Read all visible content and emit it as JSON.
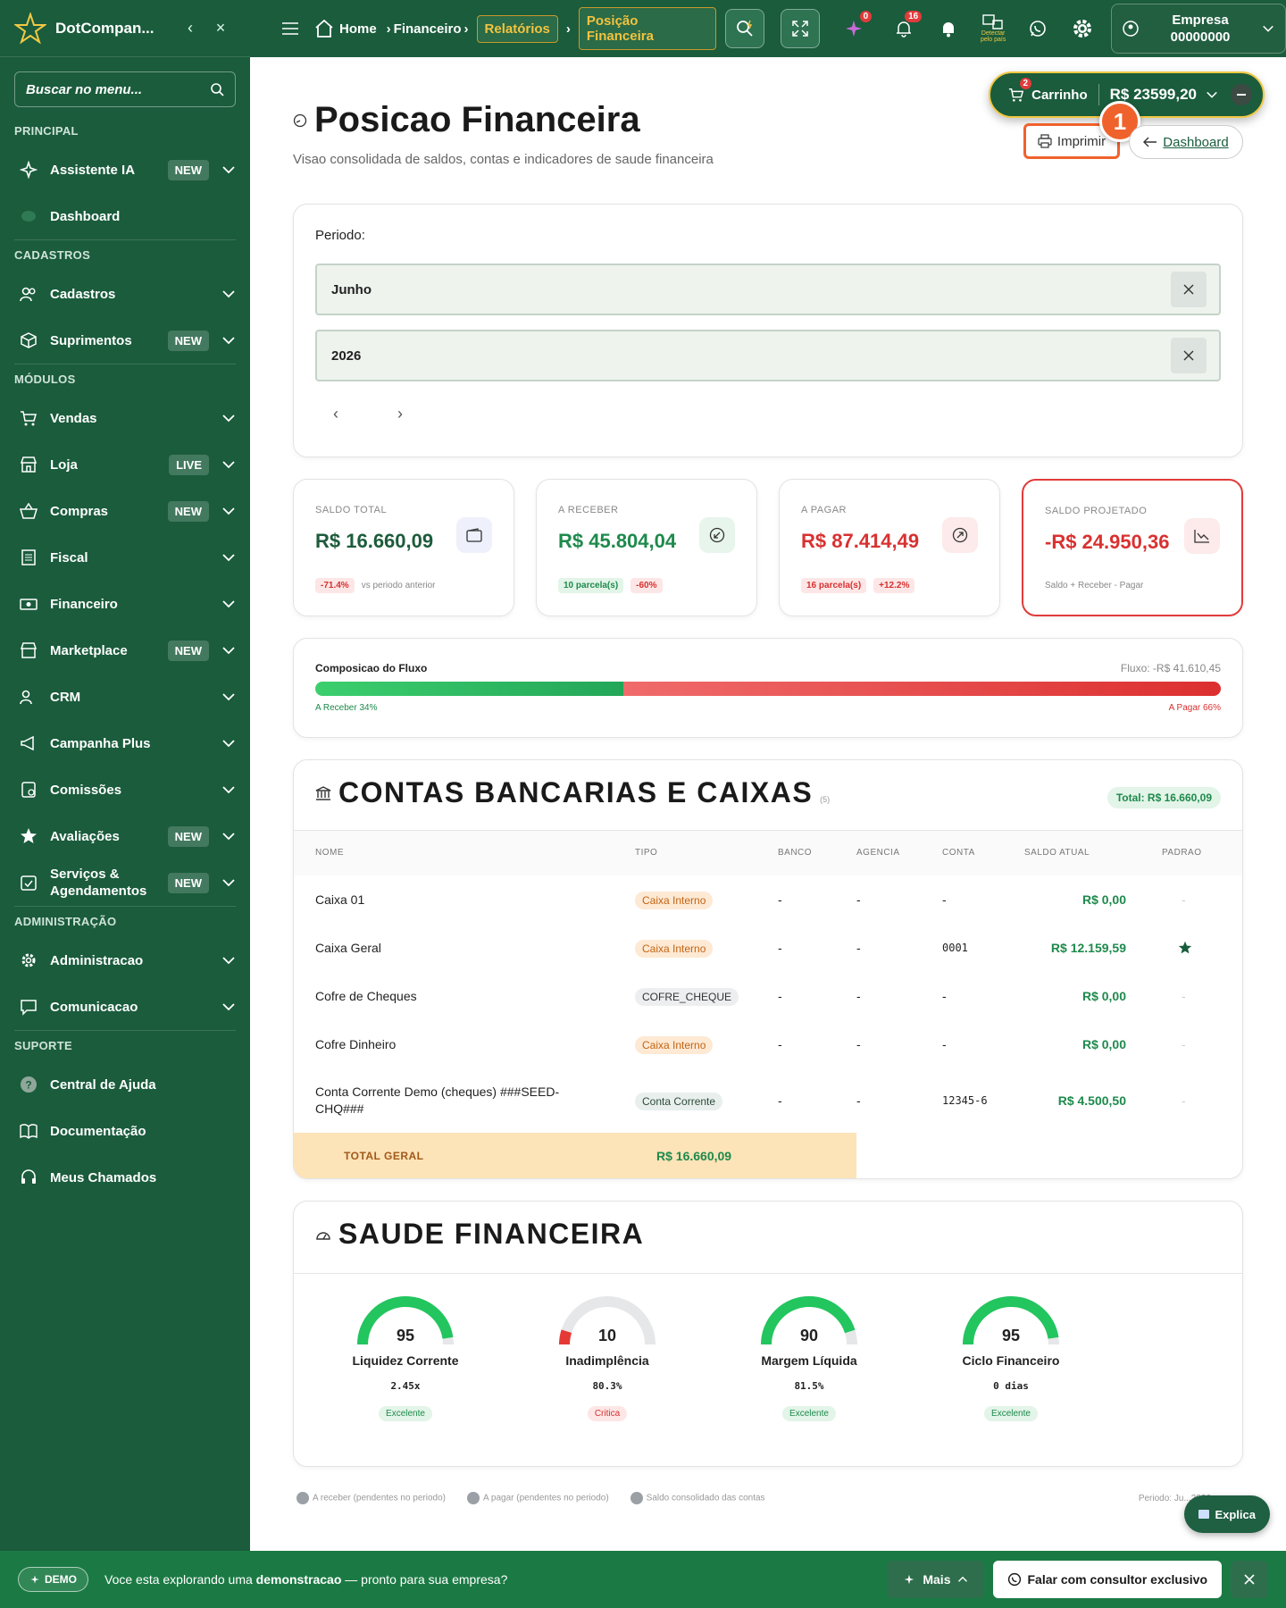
{
  "app": {
    "brand": "DotCompan..."
  },
  "sidebar": {
    "search_placeholder": "Buscar no menu...",
    "sections": {
      "principal": "PRINCIPAL",
      "cadastros": "CADASTROS",
      "modulos": "MÓDULOS",
      "administracao": "ADMINISTRAÇÃO",
      "suporte": "SUPORTE"
    },
    "items": {
      "assistente": {
        "label": "Assistente IA",
        "badge": "NEW"
      },
      "dashboard": {
        "label": "Dashboard"
      },
      "cadastros": {
        "label": "Cadastros"
      },
      "suprimentos": {
        "label": "Suprimentos",
        "badge": "NEW"
      },
      "vendas": {
        "label": "Vendas"
      },
      "loja": {
        "label": "Loja",
        "badge": "LIVE"
      },
      "compras": {
        "label": "Compras",
        "badge": "NEW"
      },
      "fiscal": {
        "label": "Fiscal"
      },
      "financeiro": {
        "label": "Financeiro"
      },
      "marketplace": {
        "label": "Marketplace",
        "badge": "NEW"
      },
      "crm": {
        "label": "CRM"
      },
      "campanha": {
        "label": "Campanha Plus"
      },
      "comissoes": {
        "label": "Comissões"
      },
      "avaliacoes": {
        "label": "Avaliações",
        "badge": "NEW"
      },
      "servicos": {
        "label": "Serviços & Agendamentos",
        "badge": "NEW"
      },
      "administracao": {
        "label": "Administracao"
      },
      "comunicacao": {
        "label": "Comunicacao"
      },
      "central": {
        "label": "Central de Ajuda"
      },
      "documentacao": {
        "label": "Documentação"
      },
      "chamados": {
        "label": "Meus Chamados"
      }
    }
  },
  "topbar": {
    "breadcrumb": {
      "home": "Home",
      "financeiro": "Financeiro",
      "relatorios": "Relatórios",
      "posicao": "Posição Financeira"
    },
    "sparkle_count": "0",
    "notif_count": "16",
    "detect_label": "Detectar pelo país",
    "company": {
      "name": "Empresa",
      "code": "00000000"
    }
  },
  "cart": {
    "label": "Carrinho",
    "count": "2",
    "amount": "R$ 23599,20"
  },
  "page": {
    "title": "Posicao Financeira",
    "subtitle": "Visao consolidada de saldos, contas e indicadores de saude financeira",
    "print_label": "Imprimir",
    "dashboard_label": "Dashboard",
    "marker": "1"
  },
  "period": {
    "label": "Periodo:",
    "month": "Junho",
    "year": "2026"
  },
  "kpis": {
    "saldo_total": {
      "label": "SALDO TOTAL",
      "value": "R$ 16.660,09",
      "tag1": "-71.4%",
      "note": "vs periodo anterior"
    },
    "a_receber": {
      "label": "A RECEBER",
      "value": "R$ 45.804,04",
      "tag1": "10 parcela(s)",
      "tag2": "-60%"
    },
    "a_pagar": {
      "label": "A PAGAR",
      "value": "R$ 87.414,49",
      "tag1": "16 parcela(s)",
      "tag2": "+12.2%"
    },
    "saldo_projetado": {
      "label": "SALDO PROJETADO",
      "value": "-R$ 24.950,36",
      "note": "Saldo + Receber - Pagar"
    }
  },
  "flow": {
    "title": "Composicao do Fluxo",
    "total": "Fluxo: -R$ 41.610,45",
    "receber_label": "A Receber 34%",
    "pagar_label": "A Pagar 66%",
    "receber_pct": 34,
    "pagar_pct": 66
  },
  "accounts": {
    "title": "CONTAS BANCARIAS E CAIXAS",
    "count": "(5)",
    "total_badge": "Total: R$ 16.660,09",
    "headers": [
      "NOME",
      "TIPO",
      "BANCO",
      "AGENCIA",
      "CONTA",
      "SALDO ATUAL",
      "PADRAO"
    ],
    "rows": [
      {
        "nome": "Caixa 01",
        "tipo": "Caixa Interno",
        "banco": "-",
        "agencia": "-",
        "conta": "-",
        "saldo": "R$ 0,00",
        "padrao": "-"
      },
      {
        "nome": "Caixa Geral",
        "tipo": "Caixa Interno",
        "banco": "-",
        "agencia": "-",
        "conta": "0001",
        "saldo": "R$ 12.159,59",
        "padrao": "star"
      },
      {
        "nome": "Cofre de Cheques",
        "tipo": "COFRE_CHEQUE",
        "banco": "-",
        "agencia": "-",
        "conta": "-",
        "saldo": "R$ 0,00",
        "padrao": "-"
      },
      {
        "nome": "Cofre Dinheiro",
        "tipo": "Caixa Interno",
        "banco": "-",
        "agencia": "-",
        "conta": "-",
        "saldo": "R$ 0,00",
        "padrao": "-"
      },
      {
        "nome": "Conta Corrente Demo (cheques) ###SEED-CHQ###",
        "tipo": "Conta Corrente",
        "banco": "-",
        "agencia": "-",
        "conta": "12345-6",
        "saldo": "R$ 4.500,50",
        "padrao": "-"
      }
    ],
    "total_label": "TOTAL GERAL",
    "total_value": "R$ 16.660,09"
  },
  "health": {
    "title": "SAUDE FINANCEIRA",
    "gauges": [
      {
        "score": "95",
        "name": "Liquidez Corrente",
        "metric": "2.45x",
        "status": "Excelente",
        "level": 0.95,
        "color": "#22c55e"
      },
      {
        "score": "10",
        "name": "Inadimplência",
        "metric": "80.3%",
        "status": "Critica",
        "level": 0.1,
        "color": "#e53935"
      },
      {
        "score": "90",
        "name": "Margem Líquida",
        "metric": "81.5%",
        "status": "Excelente",
        "level": 0.9,
        "color": "#22c55e"
      },
      {
        "score": "95",
        "name": "Ciclo Financeiro",
        "metric": "0 dias",
        "status": "Excelente",
        "level": 0.95,
        "color": "#22c55e"
      }
    ]
  },
  "legend": {
    "a": "A receber (pendentes no periodo)",
    "b": "A pagar (pendentes no periodo)",
    "c": "Saldo consolidado das contas",
    "periodo": "Periodo: Ju...2026"
  },
  "explica": "Explica",
  "demo": {
    "tag": "DEMO",
    "msg_pre": "Voce esta explorando uma ",
    "msg_bold": "demonstracao",
    "msg_post": " — pronto para sua empresa?",
    "mais": "Mais",
    "consultor": "Falar com consultor exclusivo"
  }
}
